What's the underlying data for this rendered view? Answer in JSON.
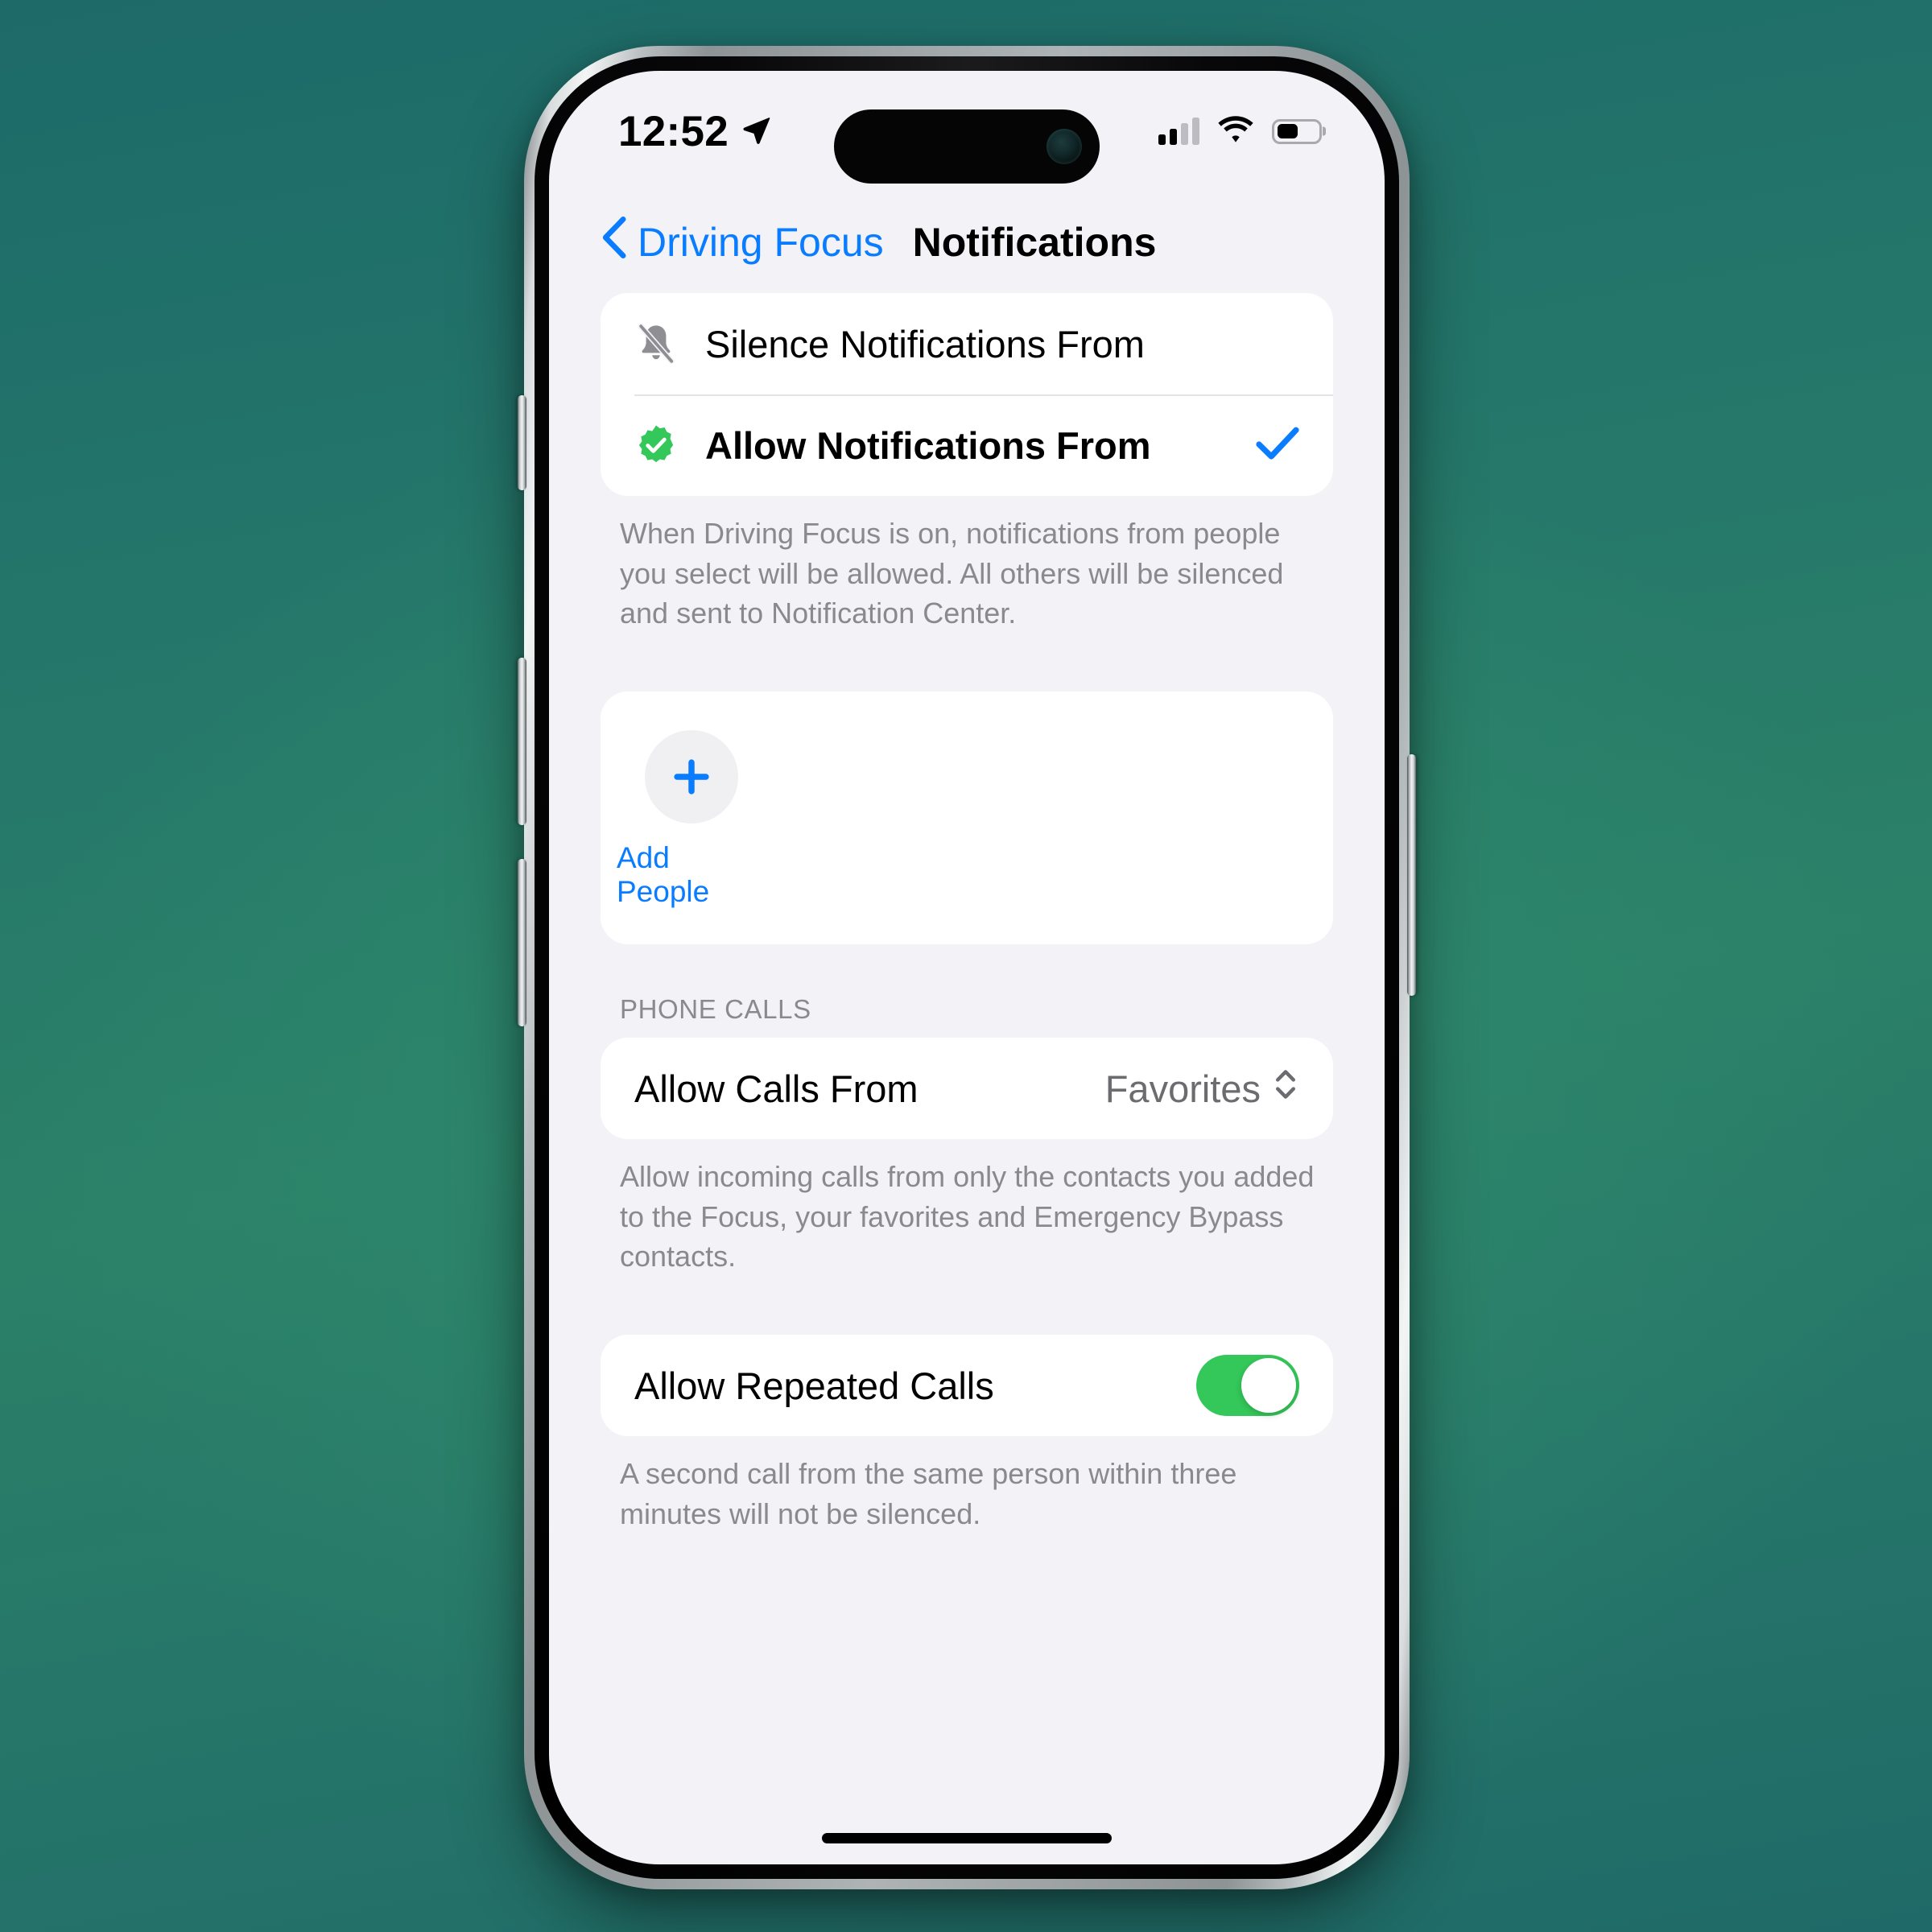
{
  "status_bar": {
    "time": "12:52",
    "location_icon": "location-arrow-icon",
    "cellular_icon": "cellular-signal-icon",
    "cellular_bars_filled": 2,
    "cellular_bars_total": 4,
    "wifi_icon": "wifi-icon",
    "battery_icon": "battery-icon",
    "battery_percent": 52
  },
  "nav": {
    "back_label": "Driving Focus",
    "back_icon": "chevron-left-icon",
    "title": "Notifications"
  },
  "mode_section": {
    "rows": [
      {
        "label": "Silence Notifications From",
        "icon": "bell-slash-icon",
        "selected": false
      },
      {
        "label": "Allow Notifications From",
        "icon": "green-check-badge-icon",
        "selected": true,
        "check_icon": "checkmark-icon"
      }
    ],
    "footnote": "When Driving Focus is on, notifications from people you select will be allowed. All others will be silenced and sent to Notification Center."
  },
  "people_section": {
    "add_label": "Add People",
    "add_icon": "plus-icon"
  },
  "phone_calls_section": {
    "header": "PHONE CALLS",
    "allow_calls": {
      "label": "Allow Calls From",
      "value": "Favorites",
      "selector_icon": "chevron-up-down-icon"
    },
    "allow_calls_footnote": "Allow incoming calls from only the contacts you added to the Focus, your favorites and Emergency Bypass contacts.",
    "repeated_calls": {
      "label": "Allow Repeated Calls",
      "toggle_icon": "toggle-switch-on",
      "enabled": true
    },
    "repeated_calls_footnote": "A second call from the same person within three minutes will not be silenced."
  },
  "colors": {
    "accent_blue": "#0a7cff",
    "toggle_green": "#34c759",
    "badge_green": "#34c759",
    "background_teal": "#2b8168",
    "screen_bg": "#f2f2f7"
  }
}
